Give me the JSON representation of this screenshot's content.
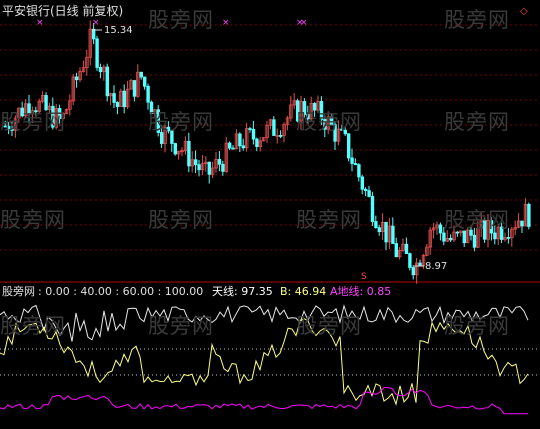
{
  "colors": {
    "background": "#000000",
    "up": "#e05050",
    "down": "#54ffff",
    "grid": "#7a0000",
    "indicator_white": "#e8e8e8",
    "indicator_yellow": "#ffff80",
    "indicator_magenta": "#ff00ff",
    "label": "#e0e0e0"
  },
  "main_panel": {
    "title": "平安银行(日线 前复权)",
    "high_label": "15.34",
    "low_label": "8.97",
    "marker_down_symbol": "×",
    "marker_up_symbol": "◇",
    "marker_bottom_symbol": "S"
  },
  "indicator_panel": {
    "name": "股旁网",
    "params": ": 0.00 : 40.00 : 60.00 : 100.00",
    "sky_label": "天线: 97.35",
    "b_label": "B: 46.94",
    "earth_label": "A地线: 0.85"
  },
  "watermark": "股旁网",
  "chart_data": {
    "type": "candlestick",
    "title": "平安银行(日线 前复权)",
    "high": 15.34,
    "low": 8.97,
    "indicator_levels": [
      0,
      40,
      60,
      100
    ],
    "sky_line_last": 97.35,
    "b_last": 46.94,
    "earth_line_last": 0.85
  }
}
